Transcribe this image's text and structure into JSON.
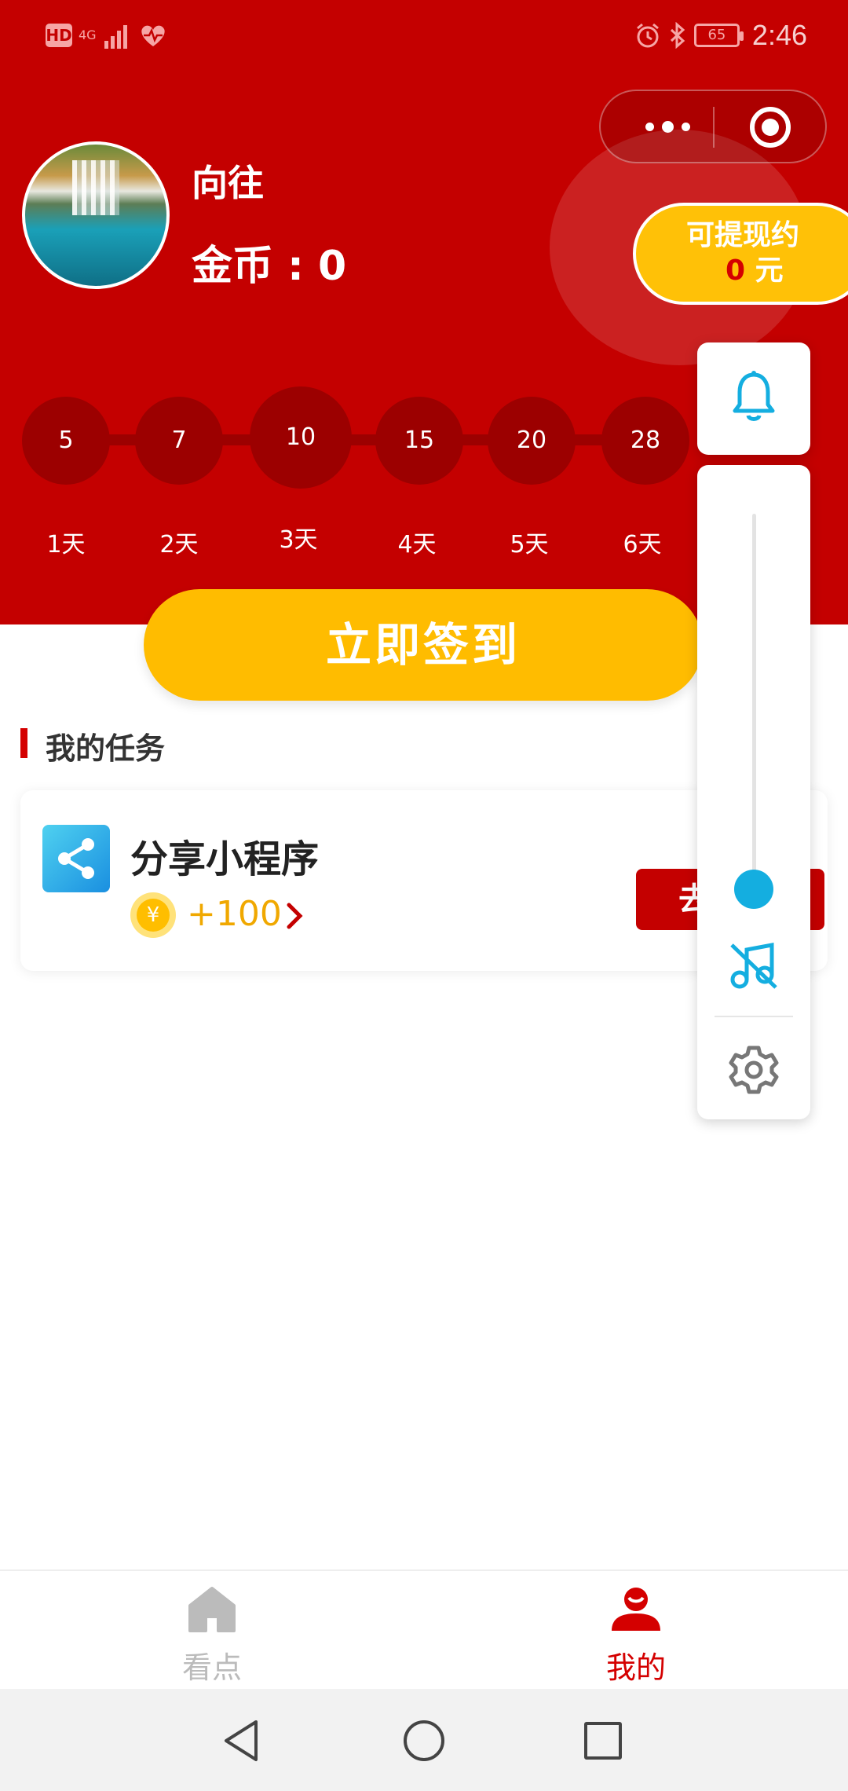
{
  "status_bar": {
    "time": "2:46",
    "battery": "65",
    "hd": "HD",
    "network": "4G"
  },
  "profile": {
    "username": "向往",
    "coins_text": "金币 : 0"
  },
  "withdraw": {
    "label": "可提现约",
    "amount": "0",
    "unit": "元"
  },
  "signin": {
    "days": [
      {
        "reward": "5",
        "label": "1天"
      },
      {
        "reward": "7",
        "label": "2天"
      },
      {
        "reward": "10",
        "label": "3天",
        "active": true
      },
      {
        "reward": "15",
        "label": "4天"
      },
      {
        "reward": "20",
        "label": "5天"
      },
      {
        "reward": "28",
        "label": "6天"
      }
    ],
    "button_label": "立即签到"
  },
  "tasks": {
    "section_title": "我的任务",
    "items": [
      {
        "name": "分享小程序",
        "reward": "+100",
        "action_label": "去",
        "icon": "share-icon"
      }
    ]
  },
  "float_panel": {
    "icons": [
      "bell-icon",
      "music-off-icon",
      "gear-icon"
    ],
    "slider_value": 0.1
  },
  "tabs": [
    {
      "label": "看点",
      "icon": "home-icon",
      "active": false
    },
    {
      "label": "我的",
      "icon": "user-icon",
      "active": true
    }
  ],
  "colors": {
    "brand_red": "#c40000",
    "accent_yellow": "#ffbc00",
    "accent_blue": "#14aee0",
    "inactive_gray": "#bbbbbb"
  }
}
